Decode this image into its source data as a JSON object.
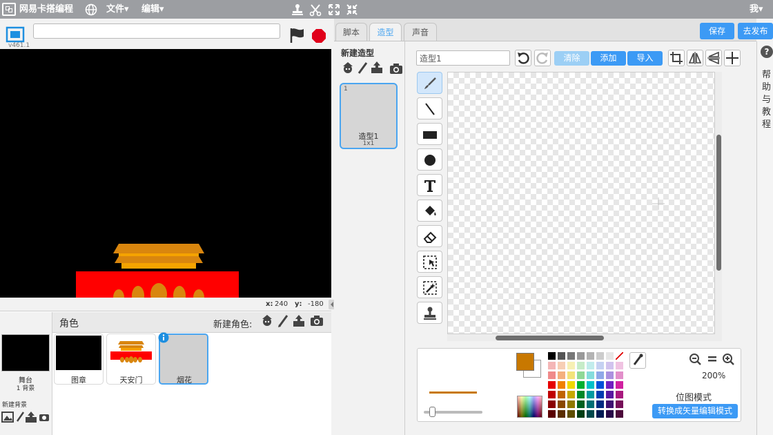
{
  "topbar": {
    "app_name": "网易卡搭编程",
    "menu_file": "文件▾",
    "menu_edit": "编辑▾",
    "user": "我▾"
  },
  "stage": {
    "title_value": "",
    "version": "v461.1",
    "x_label": "x:",
    "x_value": "240",
    "y_label": "y:",
    "y_value": "-180"
  },
  "sprite_panel": {
    "header": "角色",
    "new_sprite_label": "新建角色:",
    "stage_label": "舞台",
    "stage_sub": "1 背景",
    "new_backdrop_label": "新建背景",
    "sprites": [
      {
        "name": "图章"
      },
      {
        "name": "天安门"
      },
      {
        "name": "烟花"
      }
    ]
  },
  "right_panel": {
    "tabs": [
      {
        "label": "脚本"
      },
      {
        "label": "造型"
      },
      {
        "label": "声音"
      }
    ],
    "save_label": "保存",
    "publish_label": "去发布",
    "new_costume_label": "新建造型",
    "costume": {
      "index": "1",
      "name": "造型1",
      "size": "1x1"
    },
    "costume_name_value": "造型1",
    "clear_label": "清除",
    "add_label": "添加",
    "import_label": "导入",
    "zoom": "200%",
    "mode_label": "位图模式",
    "convert_label": "转换成矢量编辑模式"
  },
  "help": {
    "label": "帮助与教程"
  },
  "colors": {
    "accent": "#3c9af5",
    "fill_color": "#c87800",
    "topbar": "#9c9ea2"
  }
}
